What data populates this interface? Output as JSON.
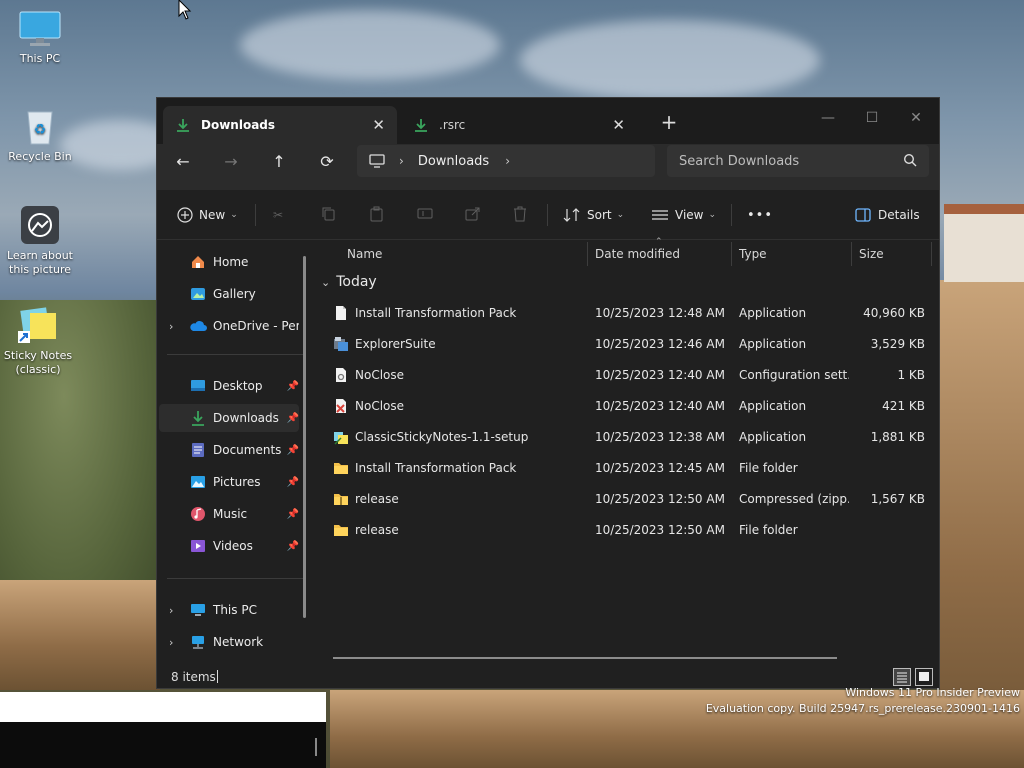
{
  "desktop": {
    "icons": [
      {
        "label": "This PC",
        "icon": "monitor-icon"
      },
      {
        "label": "Recycle Bin",
        "icon": "recycle-bin-icon"
      },
      {
        "label": "Learn about this picture",
        "icon": "camera-info-icon"
      },
      {
        "label": "Sticky Notes (classic)",
        "icon": "sticky-notes-icon"
      }
    ],
    "watermark": {
      "line1": "Windows 11 Pro Insider Preview",
      "line2": "Evaluation copy. Build 25947.rs_prerelease.230901-1416"
    }
  },
  "window": {
    "tabs": [
      {
        "label": "Downloads",
        "close": "✕",
        "active": true
      },
      {
        "label": ".rsrc",
        "close": "✕",
        "active": false
      }
    ],
    "new_tab": "+",
    "controls": {
      "minimize": "—",
      "maximize": "☐",
      "close": "✕"
    },
    "nav": {
      "back": "←",
      "forward": "→",
      "up": "↑",
      "refresh": "⟳",
      "breadcrumb": [
        "Downloads"
      ],
      "search_placeholder": "Search Downloads"
    },
    "commands": {
      "new": "New",
      "sort": "Sort",
      "view": "View",
      "more": "•••",
      "details": "Details"
    },
    "sidebar": {
      "top": [
        {
          "label": "Home",
          "icon": "home-icon"
        },
        {
          "label": "Gallery",
          "icon": "gallery-icon"
        },
        {
          "label": "OneDrive - Perso",
          "icon": "onedrive-icon"
        }
      ],
      "quick": [
        {
          "label": "Desktop",
          "icon": "desktop-icon"
        },
        {
          "label": "Downloads",
          "icon": "downloads-icon"
        },
        {
          "label": "Documents",
          "icon": "documents-icon"
        },
        {
          "label": "Pictures",
          "icon": "pictures-icon"
        },
        {
          "label": "Music",
          "icon": "music-icon"
        },
        {
          "label": "Videos",
          "icon": "videos-icon"
        }
      ],
      "bottom": [
        {
          "label": "This PC",
          "icon": "this-pc-icon"
        },
        {
          "label": "Network",
          "icon": "network-icon"
        }
      ]
    },
    "columns": {
      "name": "Name",
      "date": "Date modified",
      "type": "Type",
      "size": "Size"
    },
    "group": "Today",
    "files": [
      {
        "name": "Install Transformation Pack",
        "date": "10/25/2023 12:48 AM",
        "type": "Application",
        "size": "40,960 KB",
        "icon": "file-icon"
      },
      {
        "name": "ExplorerSuite",
        "date": "10/25/2023 12:46 AM",
        "type": "Application",
        "size": "3,529 KB",
        "icon": "app-icon"
      },
      {
        "name": "NoClose",
        "date": "10/25/2023 12:40 AM",
        "type": "Configuration sett...",
        "size": "1 KB",
        "icon": "config-file-icon"
      },
      {
        "name": "NoClose",
        "date": "10/25/2023 12:40 AM",
        "type": "Application",
        "size": "421 KB",
        "icon": "app-icon"
      },
      {
        "name": "ClassicStickyNotes-1.1-setup",
        "date": "10/25/2023 12:38 AM",
        "type": "Application",
        "size": "1,881 KB",
        "icon": "setup-icon"
      },
      {
        "name": "Install Transformation Pack",
        "date": "10/25/2023 12:45 AM",
        "type": "File folder",
        "size": "",
        "icon": "folder-icon"
      },
      {
        "name": "release",
        "date": "10/25/2023 12:50 AM",
        "type": "Compressed (zipp...",
        "size": "1,567 KB",
        "icon": "zip-folder-icon"
      },
      {
        "name": "release",
        "date": "10/25/2023 12:50 AM",
        "type": "File folder",
        "size": "",
        "icon": "folder-icon"
      }
    ],
    "status": {
      "count": "8 items"
    }
  },
  "colors": {
    "accent": "#3aa55d",
    "window_bg": "#202020",
    "folder": "#f3c04a"
  }
}
